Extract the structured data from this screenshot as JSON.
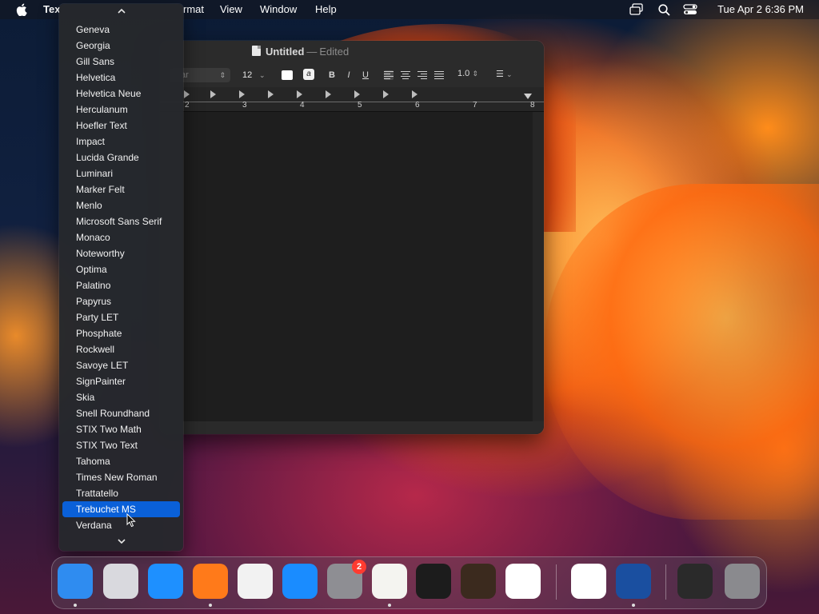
{
  "menubar": {
    "app_name_partial": "Tex",
    "items": [
      "rmat",
      "View",
      "Window",
      "Help"
    ],
    "clock": "Tue Apr 2  6:36 PM"
  },
  "window": {
    "title": "Untitled",
    "separator": "—",
    "status": "Edited",
    "toolbar": {
      "font_partial": "ar",
      "font_size": "12",
      "bold": "B",
      "italic": "I",
      "underline": "U",
      "highlight": "a",
      "line_spacing": "1.0"
    },
    "ruler_numbers": [
      "2",
      "3",
      "4",
      "5",
      "6",
      "7",
      "8"
    ]
  },
  "font_menu": {
    "scroll_up_icon": "chevron-up-icon",
    "scroll_down_icon": "chevron-down-icon",
    "items": [
      "Geneva",
      "Georgia",
      "Gill Sans",
      "Helvetica",
      "Helvetica Neue",
      "Herculanum",
      "Hoefler Text",
      "Impact",
      "Lucida Grande",
      "Luminari",
      "Marker Felt",
      "Menlo",
      "Microsoft Sans Serif",
      "Monaco",
      "Noteworthy",
      "Optima",
      "Palatino",
      "Papyrus",
      "Party LET",
      "Phosphate",
      "Rockwell",
      "Savoye LET",
      "SignPainter",
      "Skia",
      "Snell Roundhand",
      "STIX Two Math",
      "STIX Two Text",
      "Tahoma",
      "Times New Roman",
      "Trattatello",
      "Trebuchet MS",
      "Verdana"
    ],
    "selected": "Trebuchet MS"
  },
  "dock": {
    "apps": [
      {
        "name": "finder-icon",
        "color": "#2f8cf0",
        "running": true
      },
      {
        "name": "launchpad-icon",
        "color": "#d9d9de",
        "running": false
      },
      {
        "name": "safari-icon",
        "color": "#1e90ff",
        "running": false
      },
      {
        "name": "firefox-icon",
        "color": "#ff7a1a",
        "running": true
      },
      {
        "name": "chrome-icon",
        "color": "#f2f2f2",
        "running": false
      },
      {
        "name": "app-store-icon",
        "color": "#1a8cff",
        "running": false
      },
      {
        "name": "system-settings-icon",
        "color": "#8e8e93",
        "running": false,
        "badge": "2"
      },
      {
        "name": "textedit-icon",
        "color": "#f4f4f0",
        "running": true
      },
      {
        "name": "terminal-icon",
        "color": "#1c1c1c",
        "running": false
      },
      {
        "name": "garageband-icon",
        "color": "#3b2a1e",
        "running": false
      },
      {
        "name": "vscode-icon",
        "color": "#ffffff",
        "running": false
      },
      {
        "name": "photos-icon",
        "color": "#ffffff",
        "running": false
      },
      {
        "name": "affinity-designer-icon",
        "color": "#1a4fa0",
        "running": true
      },
      {
        "name": "downloads-stack-icon",
        "color": "#2a2a2a",
        "running": false
      },
      {
        "name": "trash-icon",
        "color": "#8a8a8e",
        "running": false
      }
    ]
  }
}
